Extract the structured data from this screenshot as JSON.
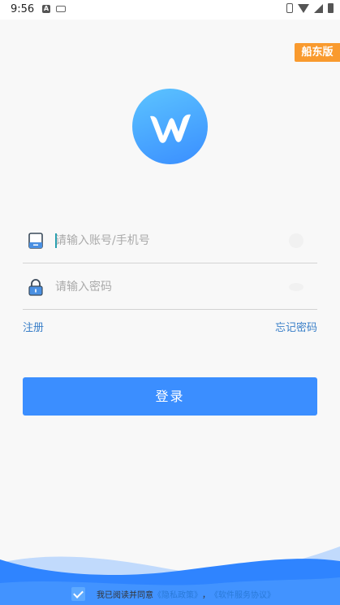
{
  "status_bar": {
    "time": "9:56",
    "a_icon": "A"
  },
  "edition_tag": "船东版",
  "account_field": {
    "placeholder": "请输入账号/手机号",
    "value": ""
  },
  "password_field": {
    "placeholder": "请输入密码",
    "value": ""
  },
  "links": {
    "register": "注册",
    "forgot": "忘记密码"
  },
  "login_button": "登录",
  "agreement": {
    "prefix": "我已阅读并同意",
    "privacy": "《隐私政策》",
    "separator": "，",
    "service": "《软件服务协议》",
    "checked": true
  },
  "colors": {
    "accent": "#3b8eff",
    "tag": "#f99a2e",
    "link": "#3a7fc8",
    "wave": "#2f84ff"
  },
  "icons": {
    "account": "account-card-icon",
    "password": "lock-icon",
    "clear": "clear-icon",
    "visibility": "eye-icon"
  }
}
